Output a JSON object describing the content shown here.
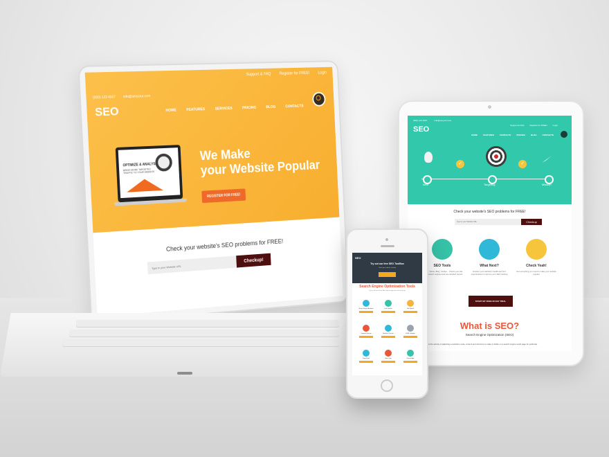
{
  "laptop": {
    "top_links": [
      "Support & FAQ",
      "Register for FREE!",
      "Login"
    ],
    "contact": [
      "(000) 123 4567",
      "info@seoyour.com"
    ],
    "logo": "SEO",
    "nav": [
      "HOME",
      "FEATURES",
      "SERVICES",
      "PRICING",
      "BLOG",
      "CONTACTS"
    ],
    "illustration": {
      "title": "OPTIMIZE & ANALYSE",
      "text": "BRING MORE TARGETED TRAFFIC TO YOUR WEBSITE"
    },
    "headline_line1": "We Make",
    "headline_line2": "your Website Popular",
    "cta": "REGISTER FOR FREE!",
    "check_title": "Check your website's SEO problems for FREE!",
    "input_placeholder": "Type in your Website URL",
    "checkup_button": "Checkup!"
  },
  "tablet": {
    "contact": [
      "(000) 123 4567",
      "info@seoyour.com"
    ],
    "top_links": [
      "Support & FAQ",
      "Register for FREE!",
      "Login"
    ],
    "logo": "SEO",
    "nav": [
      "HOME",
      "FEATURES",
      "CONTACTS",
      "PRICING",
      "BLOG",
      "CONTACTS"
    ],
    "steps": [
      "Idea",
      "Targeting",
      "Mission"
    ],
    "check_title": "Check your website's SEO problems for FREE!",
    "input_placeholder": "Type in your Website URL",
    "checkup_button": "Checkup",
    "features": [
      {
        "title": "SEO Tools",
        "desc": "Google, Yahoo, Bing, Yandex... Check your site with all search engines and see detailed reports"
      },
      {
        "title": "What Next?",
        "desc": "Explore your website's health and find opportunities to improve your SEO ranking"
      },
      {
        "title": "Check Yeah!",
        "desc": "Get everything you need to make your website popular"
      }
    ],
    "trial_button": "START MY FREE 30 DAY TRIAL",
    "what_title": "What is SEO?",
    "what_subtitle": "Search Engine Optimization (SEO)",
    "what_text": "is the activity of adjusting a website's code, content and structure to make it visible on a search engine result page for particular"
  },
  "phone": {
    "logo": "SEO",
    "title": "Try out our free SEO ToolBox",
    "subtitle": "Check your website instantly",
    "section_title": "Search Engine Optimization Tools",
    "section_desc": "Try our full set of free SEO tools and get your site to the top",
    "tools": [
      {
        "name": "Search Engine Analyzer",
        "color": "#2fb8d8"
      },
      {
        "name": "Link Checker",
        "color": "#36c3a8"
      },
      {
        "name": "Site Speed",
        "color": "#f5b43b"
      },
      {
        "name": "Keyword Density",
        "color": "#e8573b"
      },
      {
        "name": "Backlink Checker",
        "color": "#2fb8d8"
      },
      {
        "name": "HTML Validator",
        "color": "#9aa4ad"
      },
      {
        "name": "Page Rank",
        "color": "#2fb8d8"
      },
      {
        "name": "Meta Tags",
        "color": "#e8573b"
      },
      {
        "name": "Domain Age",
        "color": "#36c3a8"
      }
    ]
  },
  "colors": {
    "laptop_brand": "#f8ae2f",
    "tablet_brand": "#32c8ac",
    "button_dark": "#4e0f0f",
    "accent": "#e8573b"
  }
}
